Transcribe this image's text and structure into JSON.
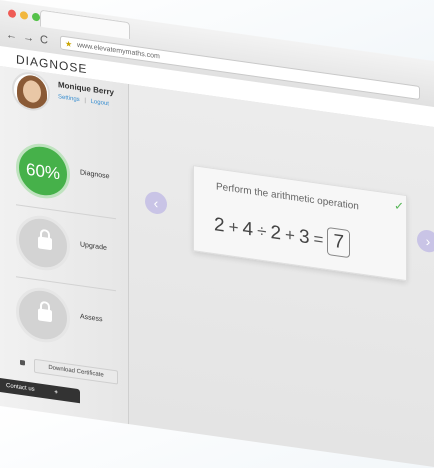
{
  "browser": {
    "url": "www.elevatemymaths.com",
    "window_dots": [
      "#ef5b55",
      "#f1b73d",
      "#55c24a"
    ],
    "back_icon": "back-arrow-icon",
    "forward_icon": "forward-arrow-icon",
    "reload_icon": "reload-icon"
  },
  "app": {
    "title": "DIAGNOSE"
  },
  "user": {
    "name": "Monique Berry",
    "settings": "Settings",
    "separator": "|",
    "logout": "Logout"
  },
  "sidebar": {
    "items": [
      {
        "label": "Diagnose",
        "progress_text": "60%",
        "progress": 0.6,
        "locked": false
      },
      {
        "label": "Upgrade",
        "locked": true
      },
      {
        "label": "Assess",
        "locked": true
      }
    ],
    "download": "Download Certificate",
    "contact": "Contact us",
    "contact_plus": "+"
  },
  "exercise": {
    "prompt": "Perform the arithmetic operation",
    "check_icon": "checkmark-icon",
    "terms": [
      "2",
      "+",
      "4",
      "÷",
      "2",
      "+",
      "3",
      "="
    ],
    "answer": "7",
    "prev_icon": "chevron-left-icon",
    "next_icon": "chevron-right-icon"
  },
  "colors": {
    "progress_green": "#46b14a",
    "link_blue": "#3a8fd0",
    "nav_arrow": "#c9c4e6"
  }
}
